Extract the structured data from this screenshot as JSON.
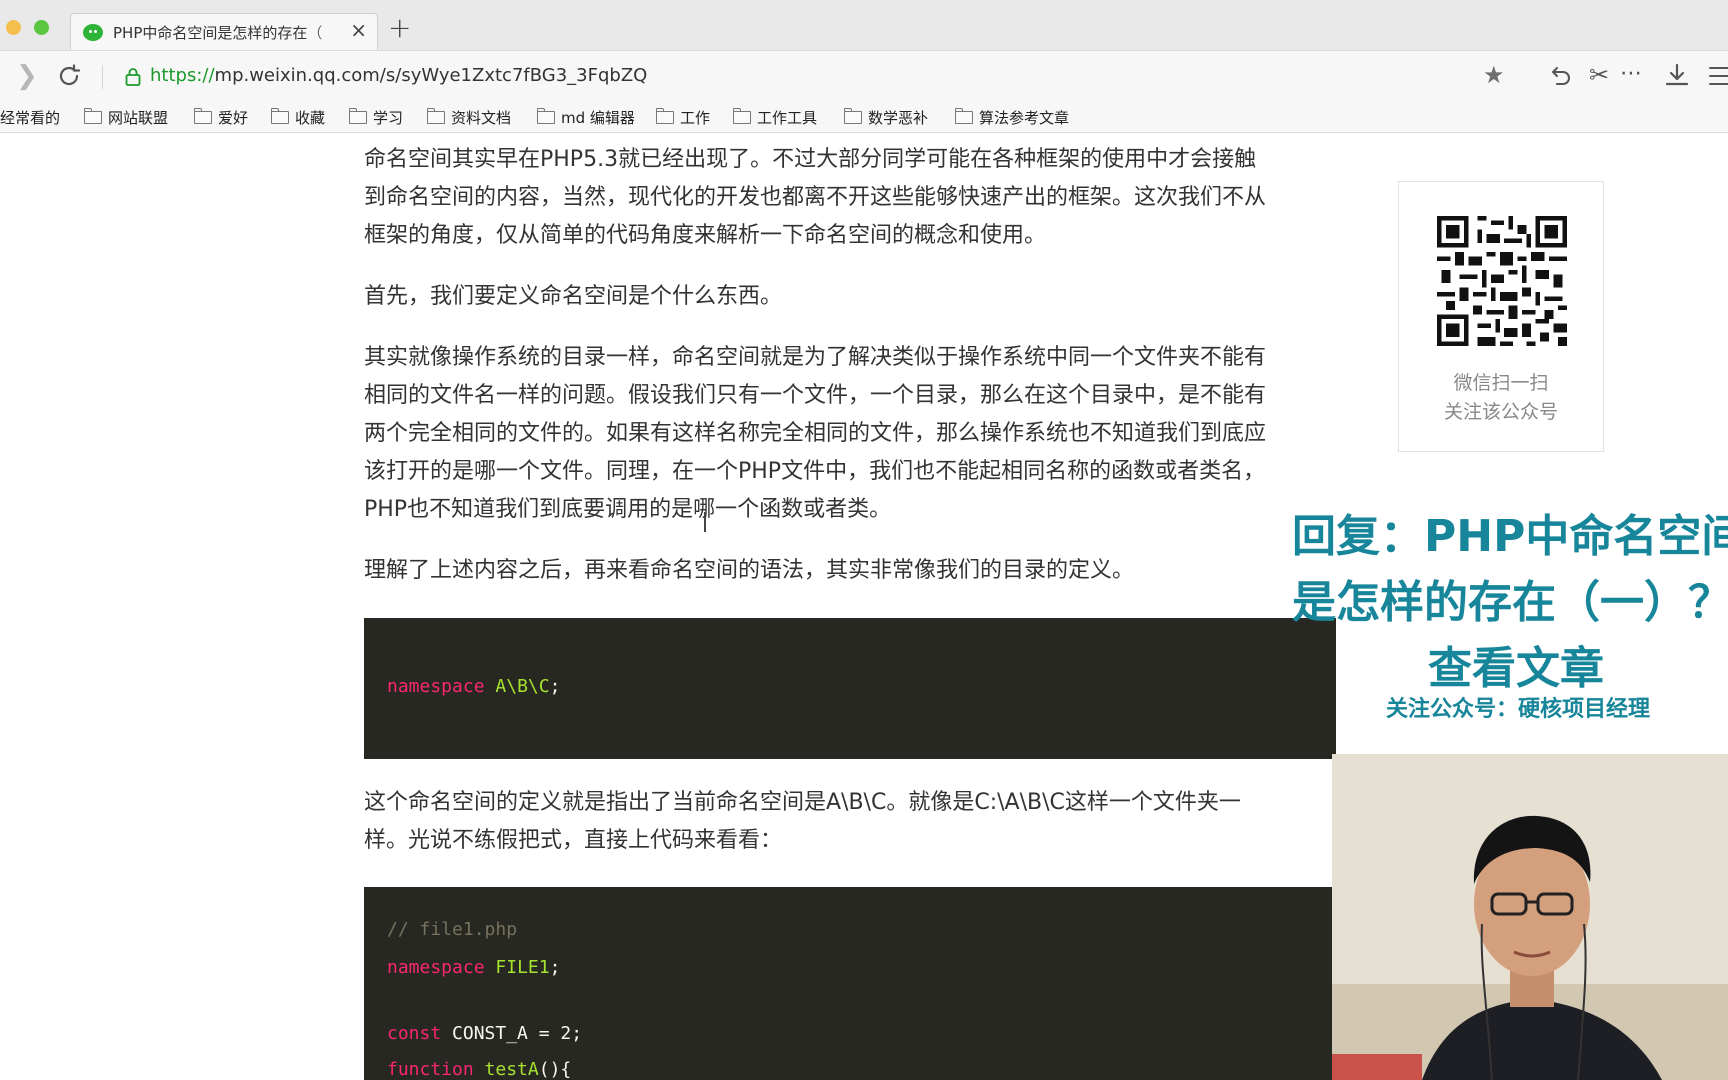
{
  "window": {
    "tab_title": "PHP中命名空间是怎样的存在（",
    "tab_close": "×",
    "new_tab": "+"
  },
  "address": {
    "url_protocol": "https://",
    "url_rest": "mp.weixin.qq.com/s/syWye1Zxtc7fBG3_3FqbZQ"
  },
  "toolbar": {
    "star": "★",
    "cut": "✂",
    "more": "⋯"
  },
  "bookmarks": {
    "first": "经常看的",
    "items": [
      "网站联盟",
      "爱好",
      "收藏",
      "学习",
      "资料文档",
      "md 编辑器",
      "工作",
      "工作工具",
      "数学恶补",
      "算法参考文章"
    ]
  },
  "article": {
    "p1": [
      "命名空间其实早在PHP5.3就已经出现了。不过大部分同学可能在各种框架的使用中才会接触",
      "到命名空间的内容，当然，现代化的开发也都离不开这些能够快速产出的框架。这次我们不从",
      "框架的角度，仅从简单的代码角度来解析一下命名空间的概念和使用。"
    ],
    "p2": "首先，我们要定义命名空间是个什么东西。",
    "p3": [
      "其实就像操作系统的目录一样，命名空间就是为了解决类似于操作系统中同一个文件夹不能有",
      "相同的文件名一样的问题。假设我们只有一个文件，一个目录，那么在这个目录中，是不能有",
      "两个完全相同的文件的。如果有这样名称完全相同的文件，那么操作系统也不知道我们到底应",
      "该打开的是哪一个文件。同理，在一个PHP文件中，我们也不能起相同名称的函数或者类名，",
      "PHP也不知道我们到底要调用的是哪一个函数或者类。"
    ],
    "p4": "理解了上述内容之后，再来看命名空间的语法，其实非常像我们的目录的定义。",
    "code1": {
      "kw": "namespace",
      "name": "A\\B\\C",
      "end": ";"
    },
    "p5": [
      "这个命名空间的定义就是指出了当前命名空间是A\\B\\C。就像是C:\\A\\B\\C这样一个文件夹一",
      "样。光说不练假把式，直接上代码来看看："
    ],
    "code2": {
      "comment": "// file1.php",
      "ns_kw": "namespace",
      "ns_name": "FILE1",
      "ns_end": ";",
      "const_kw": "const",
      "const_rest": " CONST_A = 2;",
      "func_kw": "function",
      "func_name": "testA",
      "func_rest": "(){"
    }
  },
  "qr": {
    "line1": "微信扫一扫",
    "line2": "关注该公众号"
  },
  "promo": {
    "line1": "回复：PHP中命名空间",
    "line2": "是怎样的存在（一）？",
    "line3": "查看文章",
    "line4": "关注公众号：硬核项目经理"
  },
  "colors": {
    "accent": "#17859a",
    "url_green": "#1a9a2a",
    "code_bg": "#272822",
    "keyword": "#f92672",
    "identifier": "#a6e22e"
  }
}
